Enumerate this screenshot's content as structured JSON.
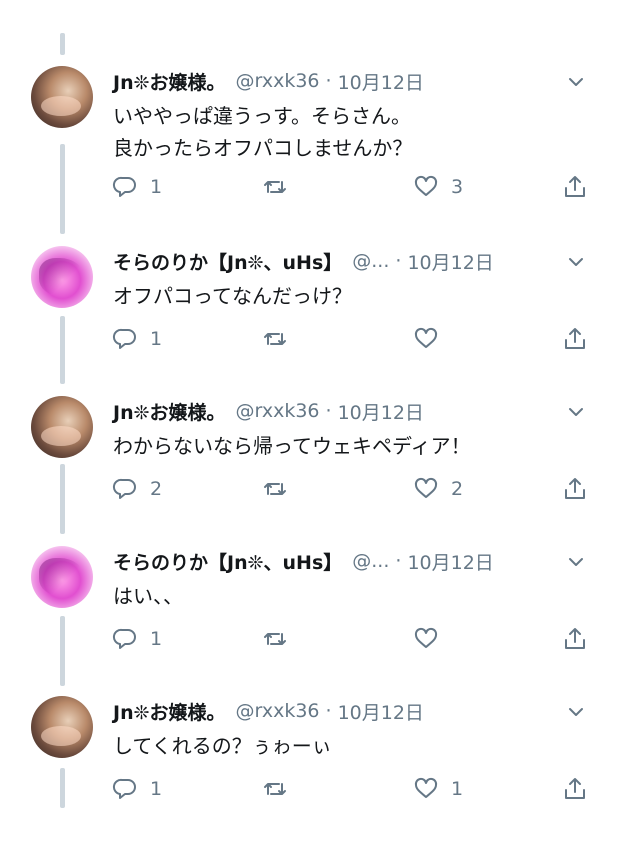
{
  "tweets": [
    {
      "author": "Jn❊お嬢様。",
      "handle": "@rxxk36",
      "sep": "·",
      "time": "10月12日",
      "lines": [
        "いややっぱ違うっす。そらさん。",
        "良かったらオフパコしませんか？"
      ],
      "reply_count": "1",
      "retweet_count": "",
      "like_count": "3"
    },
    {
      "author": "そらのりか【Jn❊、uHs】",
      "handle": "@...",
      "sep": "·",
      "time": "10月12日",
      "lines": [
        "オフパコってなんだっけ？"
      ],
      "reply_count": "1",
      "retweet_count": "",
      "like_count": ""
    },
    {
      "author": "Jn❊お嬢様。",
      "handle": "@rxxk36",
      "sep": "·",
      "time": "10月12日",
      "lines": [
        "わからないなら帰ってウェキペディア！"
      ],
      "reply_count": "2",
      "retweet_count": "",
      "like_count": "2"
    },
    {
      "author": "そらのりか【Jn❊、uHs】",
      "handle": "@...",
      "sep": "·",
      "time": "10月12日",
      "lines": [
        "はい、、"
      ],
      "reply_count": "1",
      "retweet_count": "",
      "like_count": ""
    },
    {
      "author": "Jn❊お嬢様。",
      "handle": "@rxxk36",
      "sep": "·",
      "time": "10月12日",
      "lines": [
        "してくれるの？ぅゎーぃ"
      ],
      "reply_count": "1",
      "retweet_count": "",
      "like_count": "1"
    }
  ],
  "icons": {
    "reply": "reply-icon",
    "retweet": "retweet-icon",
    "like": "heart-icon",
    "share": "share-icon",
    "more": "chevron-down-icon"
  },
  "colors": {
    "text": "#14171a",
    "secondary": "#657786",
    "thread_line": "#cdd6dd",
    "background": "#ffffff"
  }
}
